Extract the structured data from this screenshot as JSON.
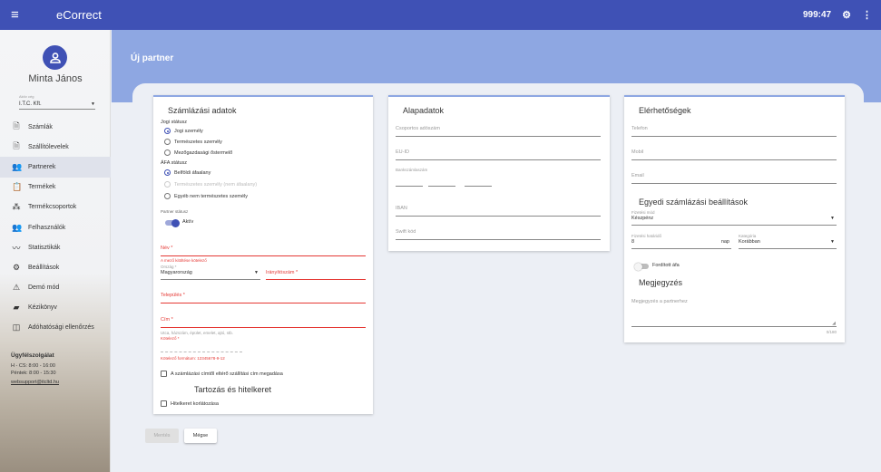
{
  "app": {
    "name": "eCorrect",
    "timer": "999:47"
  },
  "user": {
    "name": "Minta János",
    "company_label": "Aktív cég",
    "company": "I.T.C. Kft."
  },
  "nav": [
    {
      "label": "Számlák",
      "icon": "invoice-icon"
    },
    {
      "label": "Szállítólevelek",
      "icon": "delivery-note-icon"
    },
    {
      "label": "Partnerek",
      "icon": "partners-icon",
      "active": true
    },
    {
      "label": "Termékek",
      "icon": "clipboard-icon"
    },
    {
      "label": "Termékcsoportok",
      "icon": "product-groups-icon"
    },
    {
      "label": "Felhasználók",
      "icon": "users-icon"
    },
    {
      "label": "Statisztikák",
      "icon": "chart-icon"
    },
    {
      "label": "Beállítások",
      "icon": "gear-icon"
    },
    {
      "label": "Demó mód",
      "icon": "warning-icon"
    },
    {
      "label": "Kézikönyv",
      "icon": "book-icon"
    },
    {
      "label": "Adóhatósági ellenőrzés",
      "icon": "tax-check-icon"
    }
  ],
  "support": {
    "title": "Ügyfélszolgálat",
    "hours1": "H - CS: 8:00 - 16:00",
    "hours2": "Péntek: 8:00 - 15:30",
    "email": "websupport@itcltd.hu"
  },
  "page_title": "Új partner",
  "billing": {
    "title": "Számlázási adatok",
    "legal_label": "Jogi státusz",
    "legal_options": [
      "Jogi személy",
      "Természetes személy",
      "Mezőgazdasági őstermelő"
    ],
    "vat_label": "ÁFA státusz",
    "vat_options": [
      "Belföldi áfaalany",
      "Természetes személy (nem áfaalany)",
      "Egyéb nem természetes személy"
    ],
    "partner_active_label": "Partner státusz",
    "partner_active_value": "Aktív",
    "name_label": "Név *",
    "name_error": "A mező kitöltése kötelező",
    "country_label": "Ország *",
    "country": "Magyarország",
    "zip_label": "Irányítószám *",
    "city_label": "Település *",
    "address_label": "Cím *",
    "address_hint": "Utca, házszám, épület, emelet, ajtó, stb.",
    "address_error": "Kötelező *",
    "tax_error": "Kötelező formátum: 12345678-9-12",
    "separate_shipping": "A számlázási címtől eltérő szállítási cím megadása",
    "credit_title": "Tartozás és hitelkeret",
    "credit_limit": "Hitelkeret korlátozása"
  },
  "basic": {
    "title": "Alapadatok",
    "group_tax": "Csoportos adószám",
    "eu_tax": "EU-ID",
    "bank_account": "Bankszámlaszám",
    "iban": "IBAN",
    "swift": "Swift kód"
  },
  "contact": {
    "title": "Elérhetőségek",
    "phone": "Telefon",
    "mobile": "Mobil",
    "email": "Email",
    "custom_billing_title": "Egyedi számlázási beállítások",
    "payment_label": "Fizetési mód",
    "payment_value": "Készpénz",
    "deadline_label": "Fizetési határidő",
    "deadline_value": "8",
    "deadline_unit": "nap",
    "category_label": "Kategória",
    "category_value": "Korábban",
    "discount_label": "Fordított áfa",
    "note_title": "Megjegyzés",
    "note_placeholder": "Megjegyzés a partnerhez",
    "counter": "0/180"
  },
  "actions": {
    "save": "Mentés",
    "cancel": "Mégse"
  },
  "colors": {
    "primary": "#3f51b5",
    "banner": "#8ea7e2",
    "error": "#e53935"
  }
}
